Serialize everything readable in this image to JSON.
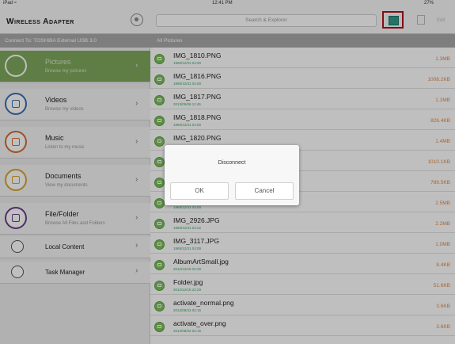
{
  "statusbar": {
    "device": "iPad ≈",
    "time": "12:41 PM",
    "battery": "27%"
  },
  "navbar": {
    "app_title": "Wireless Adapter",
    "search_placeholder": "Search & Explorer",
    "edit_label": "Edit"
  },
  "subheader": {
    "connection": "Connect To: TOSHIBA  External USB 3.0",
    "section": "All Pictures"
  },
  "sidebar": {
    "categories": [
      {
        "title": "Pictures",
        "subtitle": "Browse my pictures",
        "color": "#ffffff"
      },
      {
        "title": "Videos",
        "subtitle": "Browse my videos",
        "color": "#3a6fb0"
      },
      {
        "title": "Music",
        "subtitle": "Listen to my music",
        "color": "#d56b2f"
      },
      {
        "title": "Documents",
        "subtitle": "View my documents",
        "color": "#d9a42c"
      },
      {
        "title": "File/Folder",
        "subtitle": "Browse All Files and Folders",
        "color": "#6b3e8c"
      }
    ],
    "simple": [
      {
        "title": "Local Content"
      },
      {
        "title": "Task Manager"
      }
    ]
  },
  "files": [
    {
      "name": "IMG_1810.PNG",
      "date": "1969/12/31 04:00",
      "size": "1.3MB"
    },
    {
      "name": "IMG_1816.PNG",
      "date": "1969/12/31 04:00",
      "size": "1008.2KB"
    },
    {
      "name": "IMG_1817.PNG",
      "date": "2013/05/06 11:46",
      "size": "1.1MB"
    },
    {
      "name": "IMG_1818.PNG",
      "date": "1969/12/31 04:00",
      "size": "826.4KB"
    },
    {
      "name": "IMG_1820.PNG",
      "date": "",
      "size": "1.4MB"
    },
    {
      "name": "",
      "date": "",
      "size": "1010.1KB"
    },
    {
      "name": "",
      "date": "",
      "size": "789.5KB"
    },
    {
      "name": "IMG_2924.JPG",
      "date": "1969/12/31 04:00",
      "size": "2.5MB"
    },
    {
      "name": "IMG_2926.JPG",
      "date": "1969/12/31 04:22",
      "size": "2.2MB"
    },
    {
      "name": "IMG_3117.JPG",
      "date": "1969/12/31 04:09",
      "size": "1.0MB"
    },
    {
      "name": "AlbumArtSmall.jpg",
      "date": "2012/12/18 22:29",
      "size": "8.4KB"
    },
    {
      "name": "Folder.jpg",
      "date": "2012/12/18 22:29",
      "size": "51.6KB"
    },
    {
      "name": "activate_normal.png",
      "date": "2012/08/22 02:15",
      "size": "3.6KB"
    },
    {
      "name": "activate_over.png",
      "date": "2012/08/22 02:15",
      "size": "3.6KB"
    }
  ],
  "dialog": {
    "title": "Disconnect",
    "ok_label": "OK",
    "cancel_label": "Cancel"
  }
}
